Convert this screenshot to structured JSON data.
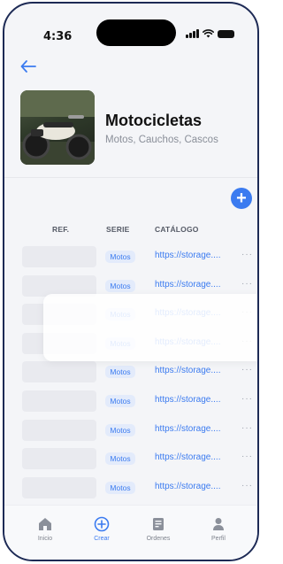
{
  "status_bar": {
    "time": "4:36"
  },
  "header": {
    "title": "Motocicletas",
    "subtitle": "Motos, Cauchos, Cascos",
    "back_icon": "arrow-left-icon",
    "image_icon": "motorcycle-photo"
  },
  "table": {
    "columns": [
      "REF.",
      "SERIE",
      "CATÁLOGO"
    ],
    "rows": [
      {
        "serie": "Motos",
        "catalogo": "https://storage....",
        "more": "···"
      },
      {
        "serie": "Motos",
        "catalogo": "https://storage....",
        "more": "···"
      },
      {
        "serie": "Motos",
        "catalogo": "https://storage....",
        "more": "···"
      },
      {
        "serie": "Motos",
        "catalogo": "https://storage....",
        "more": "···"
      },
      {
        "serie": "Motos",
        "catalogo": "https://storage....",
        "more": "···"
      },
      {
        "serie": "Motos",
        "catalogo": "https://storage....",
        "more": "···"
      },
      {
        "serie": "Motos",
        "catalogo": "https://storage....",
        "more": "···"
      },
      {
        "serie": "Motos",
        "catalogo": "https://storage....",
        "more": "···"
      },
      {
        "serie": "Motos",
        "catalogo": "https://storage....",
        "more": "···"
      }
    ]
  },
  "add_button": {
    "label": "+"
  },
  "bottom_nav": {
    "items": [
      {
        "label": "Inicio",
        "icon": "home-icon",
        "active": false
      },
      {
        "label": "Crear",
        "icon": "plus-circle-icon",
        "active": true
      },
      {
        "label": "Ordenes",
        "icon": "orders-icon",
        "active": false
      },
      {
        "label": "Perfil",
        "icon": "user-icon",
        "active": false
      }
    ]
  },
  "colors": {
    "accent": "#3b7bf0",
    "badge_bg": "#e3ebfb",
    "frame": "#1d2a55"
  }
}
